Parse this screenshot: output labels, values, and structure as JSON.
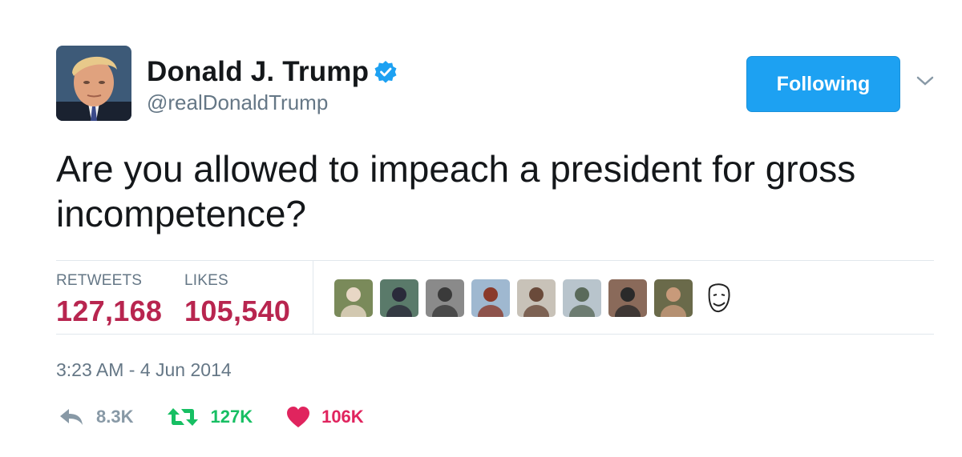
{
  "author": {
    "display_name": "Donald J. Trump",
    "handle": "@realDonaldTrump",
    "verified": true
  },
  "follow_button": {
    "label": "Following"
  },
  "tweet": {
    "text": "Are you allowed to impeach a president for gross incompetence?",
    "timestamp": "3:23 AM - 4 Jun 2014"
  },
  "stats": {
    "retweets_label": "RETWEETS",
    "retweets_value": "127,168",
    "likes_label": "LIKES",
    "likes_value": "105,540"
  },
  "likers": [
    {
      "name": "liker-avatar-1",
      "bg": "#7a8a5a",
      "fg": "#e8d7c5"
    },
    {
      "name": "liker-avatar-2",
      "bg": "#5a7a6a",
      "fg": "#2a2a3a"
    },
    {
      "name": "liker-avatar-3",
      "bg": "#8a8a8a",
      "fg": "#3a3a3a"
    },
    {
      "name": "liker-avatar-4",
      "bg": "#9fb8d0",
      "fg": "#8a3a2a"
    },
    {
      "name": "liker-avatar-5",
      "bg": "#c8c2b8",
      "fg": "#6a4a3a"
    },
    {
      "name": "liker-avatar-6",
      "bg": "#b8c4cc",
      "fg": "#5a6a5a"
    },
    {
      "name": "liker-avatar-7",
      "bg": "#8a6a5a",
      "fg": "#2a2a2a"
    },
    {
      "name": "liker-avatar-8",
      "bg": "#6a6a4a",
      "fg": "#c89a7a"
    },
    {
      "name": "liker-avatar-9",
      "bg": "#ffffff",
      "fg": "#222222"
    }
  ],
  "actions": {
    "reply_count": "8.3K",
    "retweet_count": "127K",
    "like_count": "106K"
  },
  "colors": {
    "accent": "#1da1f2",
    "stat_value": "#b8254f",
    "retweet": "#17bf63",
    "like": "#e0245e",
    "muted": "#657786"
  }
}
